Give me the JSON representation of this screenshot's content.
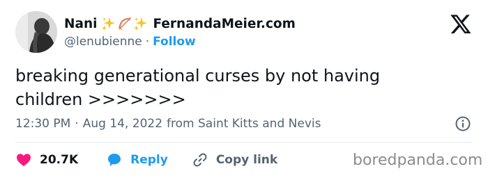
{
  "author": {
    "name": "Nani",
    "site": "FernandaMeier.com",
    "handle": "@lenubienne",
    "separator": "·",
    "follow_label": "Follow",
    "emoji": [
      "sparkles",
      "bow-and-arrow",
      "sparkles"
    ]
  },
  "tweet": {
    "text_line1": "breaking generational curses by not having",
    "text_line2": "children >>>>>>>",
    "time": "12:30 PM",
    "meta_separator": "·",
    "date": "Aug 14, 2022",
    "location": "from Saint Kitts and Nevis"
  },
  "actions": {
    "likes": "20.7K",
    "reply_label": "Reply",
    "copy_label": "Copy link"
  },
  "watermark": "boredpanda.com",
  "icons": {
    "like": "heart-icon",
    "reply": "speech-bubble-icon",
    "copy": "link-icon",
    "brand": "x-logo-icon",
    "info": "info-icon"
  },
  "colors": {
    "accent": "#1d9bf0",
    "like": "#f91880",
    "text": "#0f1419",
    "muted": "#536471",
    "sparkle": "#f7c325",
    "bow": "#d97c5f"
  }
}
